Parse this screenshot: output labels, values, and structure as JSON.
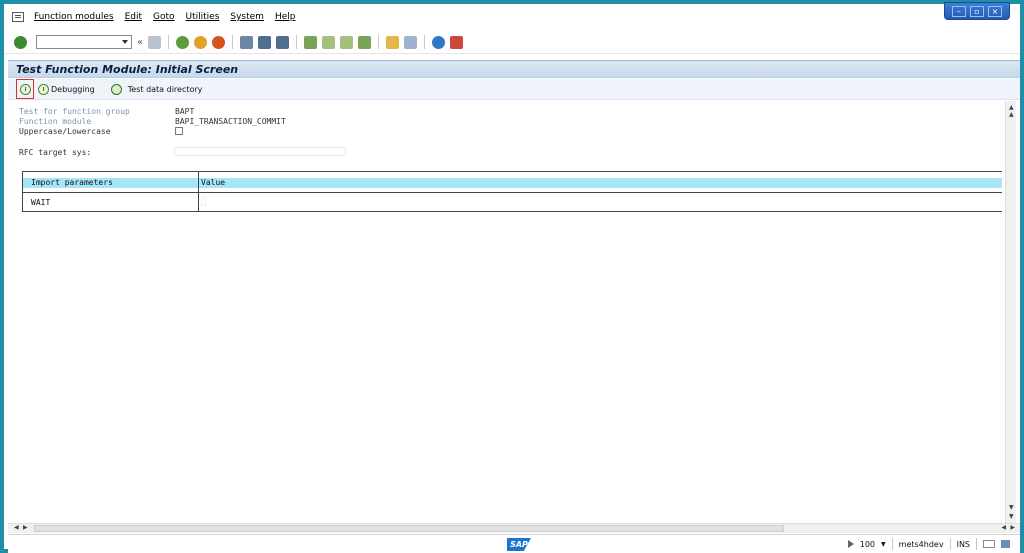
{
  "menu": {
    "items": [
      "Function modules",
      "Edit",
      "Goto",
      "Utilities",
      "System",
      "Help"
    ]
  },
  "toolbar": {
    "command_value": "",
    "icons": [
      "enter-icon",
      "save-icon",
      "back-icon",
      "exit-icon",
      "cancel-icon",
      "print-icon",
      "find-icon",
      "find-next-icon",
      "first-page-icon",
      "prev-page-icon",
      "next-page-icon",
      "last-page-icon",
      "new-session-icon",
      "shortcut-icon",
      "help-icon",
      "layout-icon"
    ]
  },
  "title": "Test Function Module: Initial Screen",
  "app_toolbar": {
    "debugging_label": "Debugging",
    "test_data_label": "Test data directory"
  },
  "form": {
    "group_label": "Test for function group",
    "group_value": "BAPT",
    "module_label": "Function module",
    "module_value": "BAPI_TRANSACTION_COMMIT",
    "case_label": "Uppercase/Lowercase",
    "rfc_label": "RFC target sys:",
    "rfc_value": ""
  },
  "table": {
    "header_param": "Import parameters",
    "header_value": "Value",
    "rows": [
      {
        "param": "WAIT",
        "value": ""
      }
    ]
  },
  "status": {
    "zoom": "100",
    "system": "mets4hdev",
    "mode": "INS"
  },
  "colors": {
    "frame": "#1f8fa8",
    "title_bg": "#c7d9ec",
    "table_header": "#a6e6f8",
    "highlight": "#d9302f"
  }
}
